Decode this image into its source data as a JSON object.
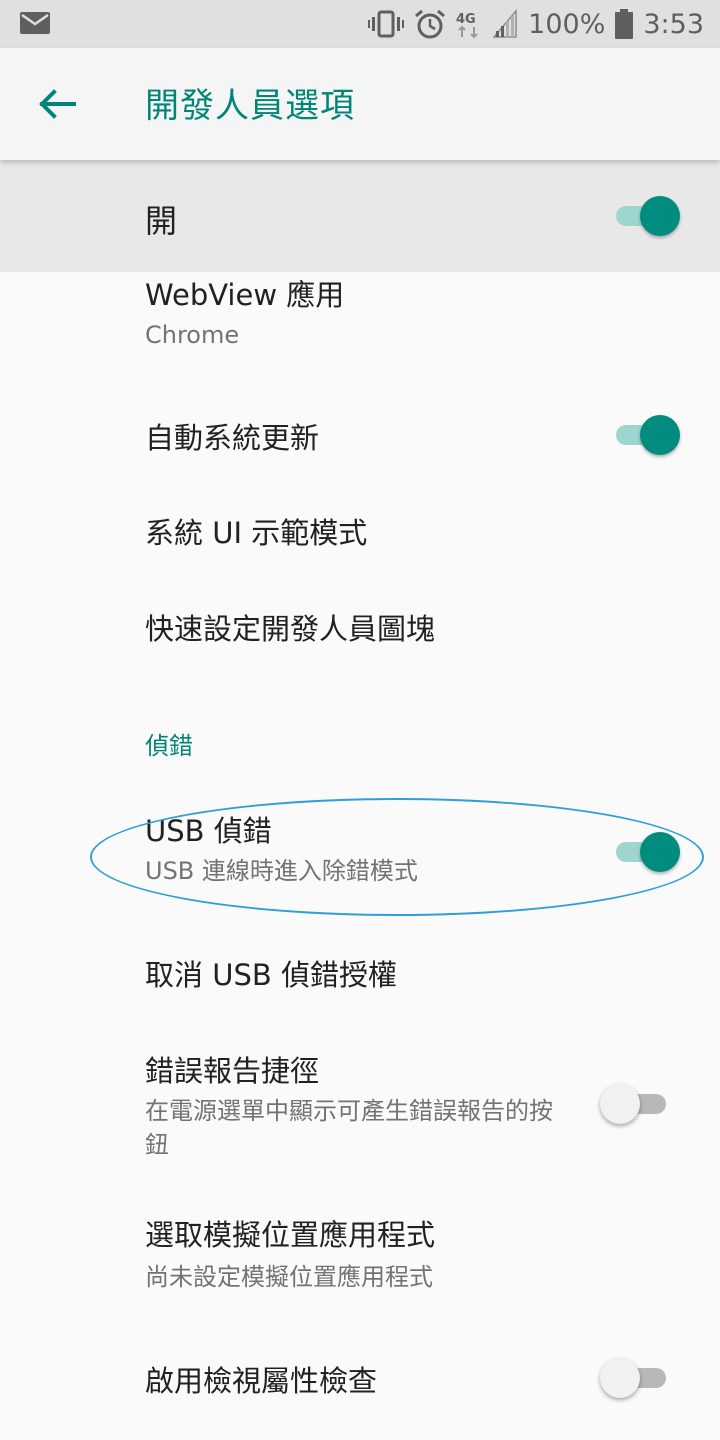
{
  "status_bar": {
    "battery_percent": "100%",
    "time": "3:53",
    "network": "4G",
    "icons": [
      "mail-icon",
      "vibrate-icon",
      "alarm-icon",
      "network-4g-icon",
      "signal-icon",
      "battery-icon"
    ]
  },
  "app_bar": {
    "title": "開發人員選項",
    "back_icon": "arrow-back-icon"
  },
  "master_switch": {
    "label": "開",
    "on": true
  },
  "items": {
    "webview": {
      "title": "WebView 應用",
      "summary": "Chrome"
    },
    "auto_update": {
      "title": "自動系統更新",
      "on": true
    },
    "demo_mode": {
      "title": "系統 UI 示範模式"
    },
    "qs_tiles": {
      "title": "快速設定開發人員圖塊"
    },
    "debug_header": "偵錯",
    "usb_debug": {
      "title": "USB 偵錯",
      "summary": "USB 連線時進入除錯模式",
      "on": true
    },
    "revoke_usb": {
      "title": "取消 USB 偵錯授權"
    },
    "bugreport": {
      "title": "錯誤報告捷徑",
      "summary": "在電源選單中顯示可產生錯誤報告的按鈕",
      "on": false
    },
    "mock_location": {
      "title": "選取模擬位置應用程式",
      "summary": "尚未設定模擬位置應用程式"
    },
    "view_attr": {
      "title": "啟用檢視屬性檢查",
      "on": false
    }
  },
  "colors": {
    "accent": "#008577",
    "switch_thumb_on": "#008d7f",
    "switch_track_on": "#9fd5cf",
    "annotation": "#2e9fd8"
  }
}
